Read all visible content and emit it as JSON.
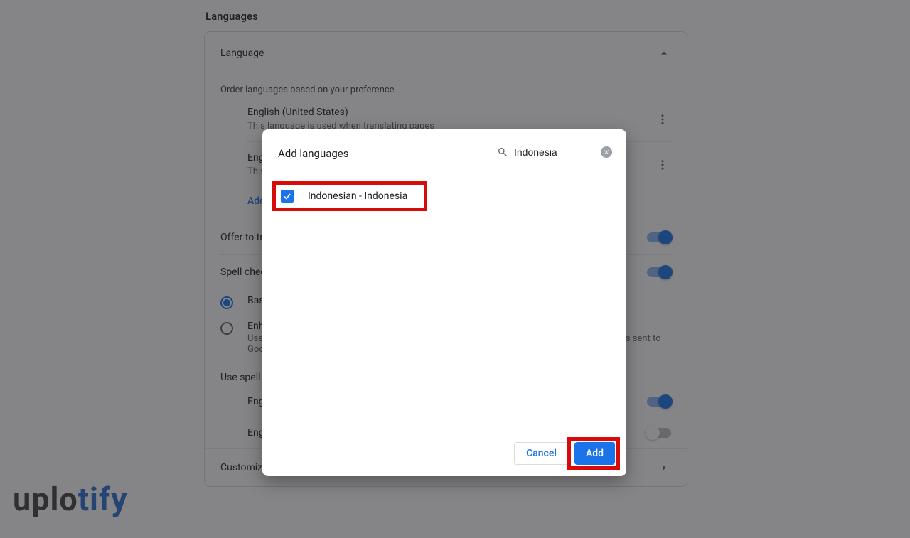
{
  "section_title": "Languages",
  "card": {
    "header": "Language",
    "order_help": "Order languages based on your preference",
    "languages": [
      {
        "name": "English (United States)",
        "desc": "This language is used when translating pages"
      },
      {
        "name": "English",
        "desc": "This"
      }
    ],
    "add_link": "Add",
    "offer_translate": "Offer to translate pages that aren't in a language you read",
    "spell_check": "Spell check",
    "radio_basic": "Basic spell check",
    "radio_enhanced": "Enhanced spell check",
    "radio_enhanced_desc": "Uses the same spell check that's used in Google products. Text that you type in the browser is sent to Google.",
    "use_spell_title": "Use spell check for",
    "spell_langs": [
      "English (United States)",
      "English"
    ],
    "customize": "Customize spell check"
  },
  "dialog": {
    "title": "Add languages",
    "search_value": "Indonesia",
    "result_label": "Indonesian - Indonesia",
    "cancel": "Cancel",
    "add": "Add"
  },
  "watermark": {
    "part1": "uplo",
    "part2": "tify"
  }
}
